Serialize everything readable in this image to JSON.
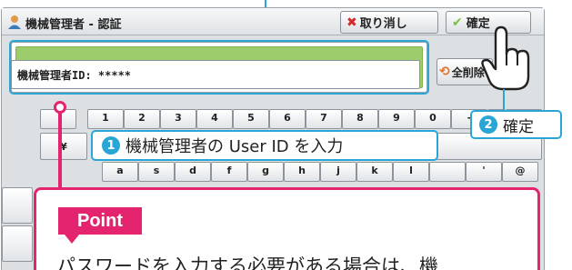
{
  "dialog": {
    "title": "機械管理者 - 認証",
    "cancel_label": "取り消し",
    "confirm_label": "確定",
    "clear_label": "全削除"
  },
  "input": {
    "value": "機械管理者ID: *****"
  },
  "keyboard": {
    "row1": [
      "",
      "1",
      "2",
      "3",
      "4",
      "5",
      "6",
      "7",
      "8",
      "9",
      "0",
      "-",
      "",
      "後"
    ],
    "row2": [
      "¥"
    ],
    "row3": [
      "a",
      "s",
      "d",
      "f",
      "g",
      "h",
      "j",
      "k",
      "l",
      "",
      "'",
      "@"
    ]
  },
  "callouts": {
    "step1": {
      "number": "1",
      "text": "機械管理者の User ID を入力"
    },
    "step2": {
      "number": "2",
      "text": "確定"
    }
  },
  "point": {
    "tag": "Point",
    "text": "パスワードを入力する必要がある場合は、機"
  },
  "colors": {
    "accent_blue": "#2aa6d6",
    "accent_pink": "#e5246f",
    "input_green": "#9ccc6b"
  }
}
